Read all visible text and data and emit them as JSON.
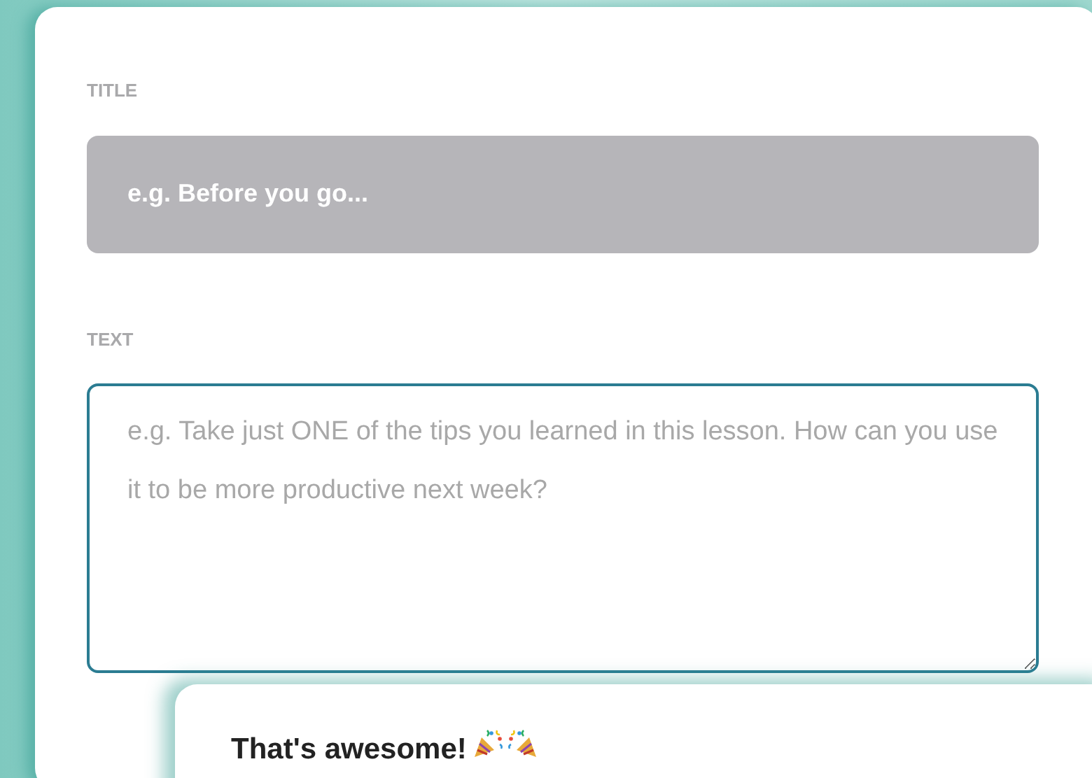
{
  "form": {
    "title_label": "TITLE",
    "title_field": {
      "placeholder": "e.g. Before you go..."
    },
    "text_label": "TEXT",
    "text_field": {
      "placeholder": "e.g. Take just ONE of the tips you learned in this lesson. How can you use it to be more productive next week?"
    }
  },
  "popup": {
    "heading": "That's awesome!"
  }
}
